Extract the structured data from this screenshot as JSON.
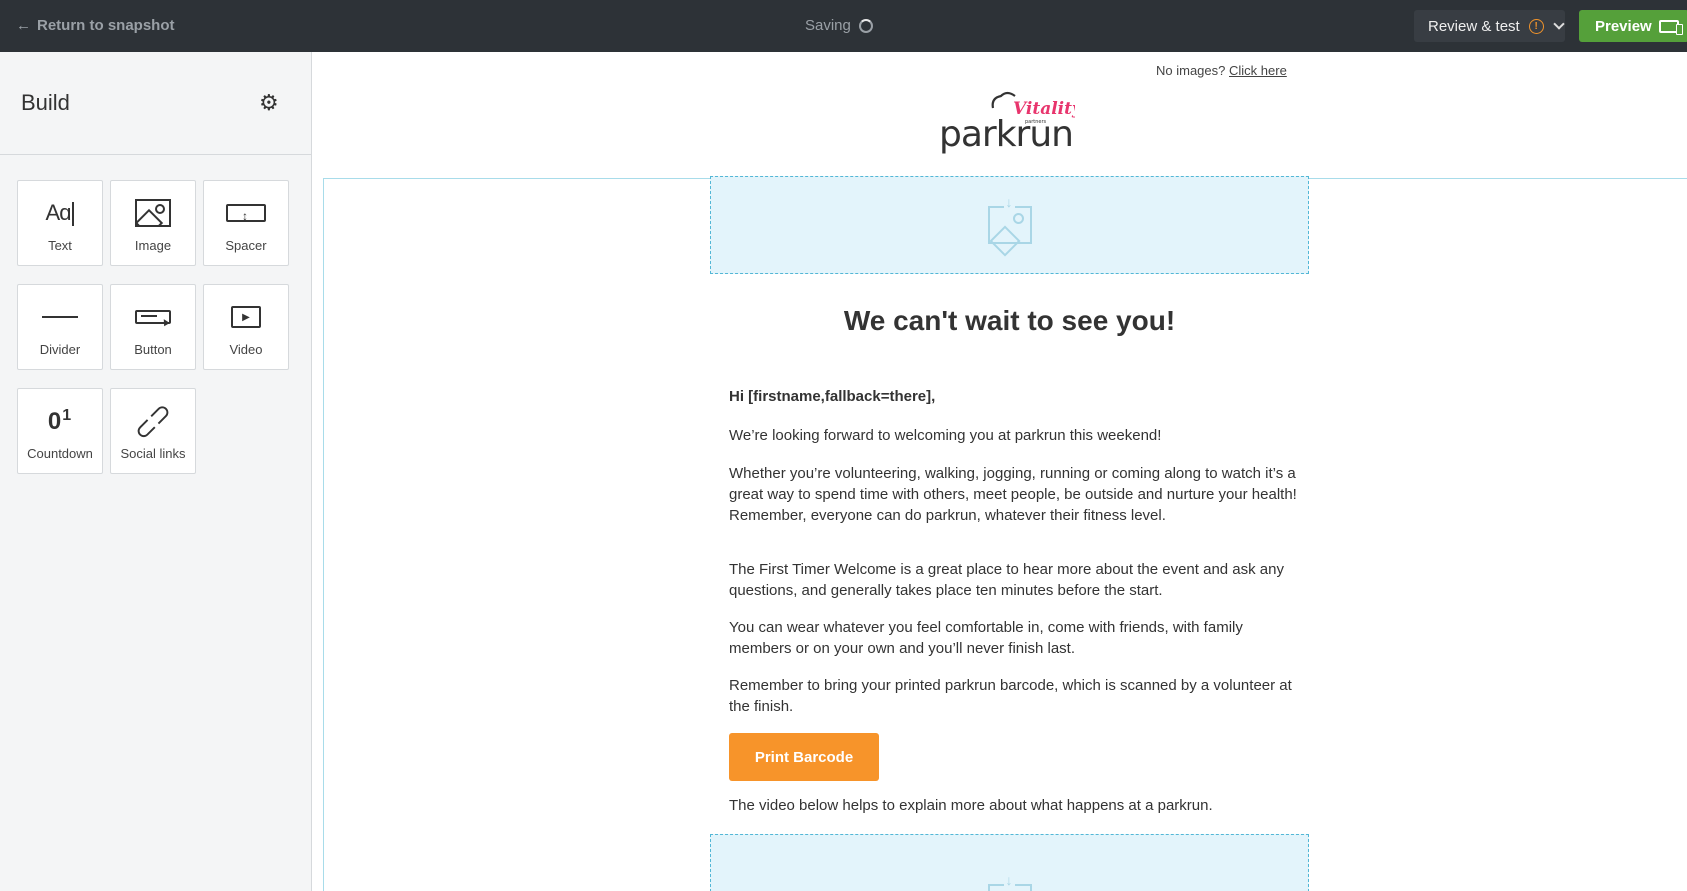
{
  "topbar": {
    "back_label": "Return to snapshot",
    "saving_label": "Saving",
    "review_label": "Review & test",
    "preview_label": "Preview"
  },
  "sidebar": {
    "title": "Build",
    "blocks": [
      {
        "label": "Text",
        "icon": "text-icon"
      },
      {
        "label": "Image",
        "icon": "image-icon"
      },
      {
        "label": "Spacer",
        "icon": "spacer-icon"
      },
      {
        "label": "Divider",
        "icon": "divider-icon"
      },
      {
        "label": "Button",
        "icon": "button-icon"
      },
      {
        "label": "Video",
        "icon": "video-icon"
      },
      {
        "label": "Countdown",
        "icon": "countdown-icon"
      },
      {
        "label": "Social links",
        "icon": "link-icon"
      }
    ]
  },
  "email": {
    "no_images_text": "No images?",
    "no_images_link": "Click here",
    "logo_brand": "parkrun",
    "logo_partner": "Vitality",
    "logo_partner_sub": "partners",
    "headline": "We can't wait to see you!",
    "greeting": "Hi [firstname,fallback=there],",
    "paragraphs": [
      "We’re looking forward to welcoming you at parkrun this weekend!",
      "Whether you’re volunteering, walking, jogging, running or coming along to watch it’s a great way to spend time with others, meet people, be outside and nurture your health! Remember, everyone can do parkrun, whatever their fitness level.",
      "The First Timer Welcome is a great place to hear more about the event and ask any questions, and generally takes place ten minutes before the start.",
      "You can wear whatever you feel comfortable in, come with friends, with family members or on your own and you’ll never finish last.",
      "Remember to bring your printed parkrun barcode, which is scanned by a volunteer at the finish."
    ],
    "cta_label": "Print Barcode",
    "after_cta": "The video below helps to explain more about what happens at a parkrun."
  },
  "colors": {
    "topbar": "#2d3237",
    "preview_green": "#55a03a",
    "cta_orange": "#f7942a",
    "placeholder_bg": "#e3f4fb",
    "brand_pink": "#e8356d"
  }
}
